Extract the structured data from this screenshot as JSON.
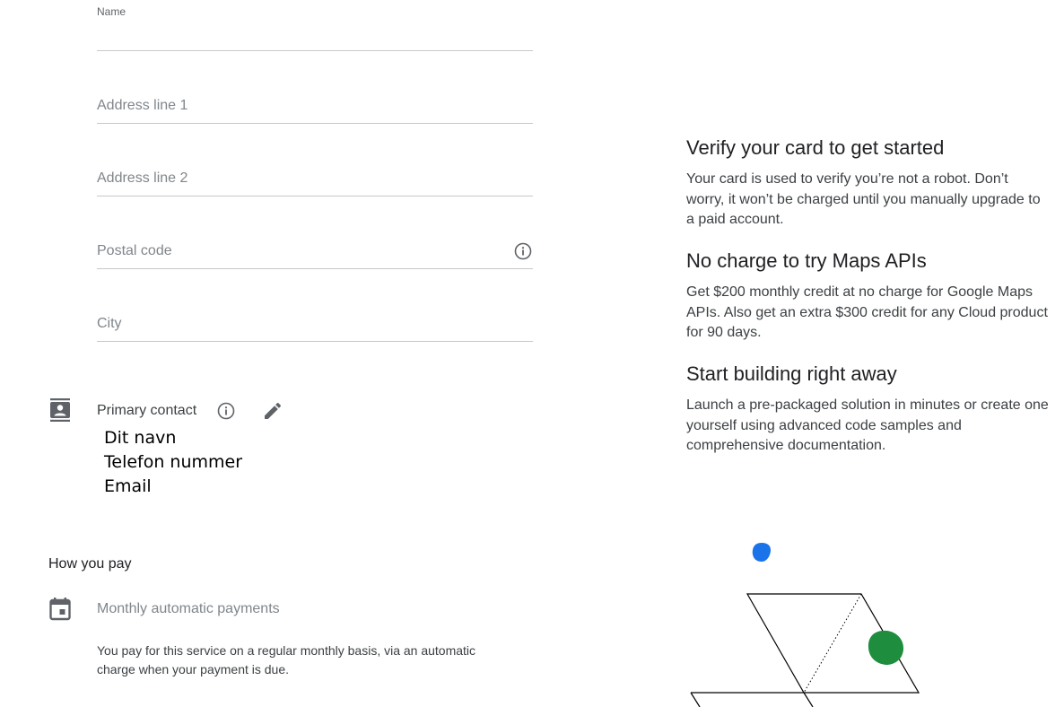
{
  "form": {
    "name_label": "Name",
    "name_value": "",
    "address1_placeholder": "Address line 1",
    "address2_placeholder": "Address line 2",
    "postal_placeholder": "Postal code",
    "city_placeholder": "City"
  },
  "primary_contact": {
    "label": "Primary contact",
    "lines": [
      "Dit navn",
      "Telefon nummer",
      "Email"
    ]
  },
  "payment": {
    "section_title": "How you pay",
    "method": "Monthly automatic payments",
    "description": "You pay for this service on a regular monthly basis, via an automatic charge when your payment is due."
  },
  "promo": {
    "blocks": [
      {
        "heading": "Verify your card to get started",
        "text": "Your card is used to verify you’re not a robot. Don’t worry, it won’t be charged until you manually upgrade to a paid account."
      },
      {
        "heading": "No charge to try Maps APIs",
        "text": "Get $200 monthly credit at no charge for Google Maps APIs. Also get an extra $300 credit for any Cloud product for 90 days."
      },
      {
        "heading": "Start building right away",
        "text": "Launch a pre-packaged solution in minutes or create one yourself using advanced code samples and comprehensive documentation."
      }
    ]
  },
  "colors": {
    "blue_dot": "#1a73e8",
    "green_dot": "#1e8e3e",
    "icon_gray": "#5f6368"
  },
  "icons": [
    "info-icon",
    "contact-card-icon",
    "pencil-icon",
    "calendar-icon"
  ]
}
